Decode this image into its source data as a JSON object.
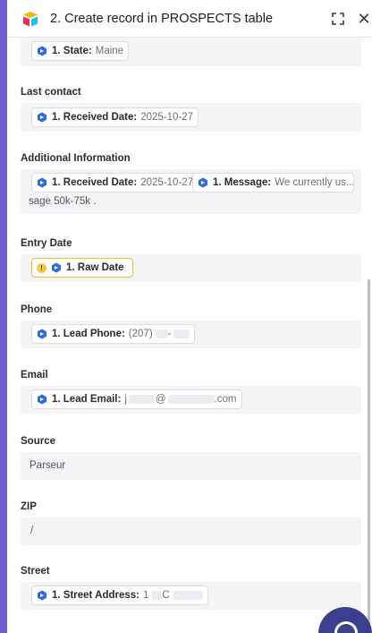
{
  "header": {
    "title": "2. Create record in PROSPECTS table"
  },
  "fields": {
    "state": {
      "step": "1. State:",
      "value": "Maine"
    },
    "last_contact": {
      "label": "Last contact",
      "step": "1. Received Date:",
      "value": "2025-10-27"
    },
    "additional": {
      "label": "Additional Information",
      "pill1_step": "1. Received Date:",
      "pill1_value": "2025-10-27",
      "pill2_step": "1. Message:",
      "pill2_value": "We currently us...",
      "tail_text": "sage  50k-75k ."
    },
    "entry_date": {
      "label": "Entry Date",
      "step": "1. Raw Date"
    },
    "phone": {
      "label": "Phone",
      "step": "1. Lead Phone:",
      "value_prefix": "(207)",
      "value_mid": "-"
    },
    "email": {
      "label": "Email",
      "step": "1. Lead Email:",
      "value_prefix": "j",
      "value_at": "@",
      "value_suffix": ".com"
    },
    "source": {
      "label": "Source",
      "value": "Parseur"
    },
    "zip": {
      "label": "ZIP",
      "value": "/"
    },
    "street": {
      "label": "Street",
      "step": "1. Street Address:",
      "value_prefix": "1",
      "value_mid": "C"
    }
  },
  "colors": {
    "accent": "#6f5bd3",
    "warning": "#e8c233",
    "chat": "#3b3f8f"
  }
}
